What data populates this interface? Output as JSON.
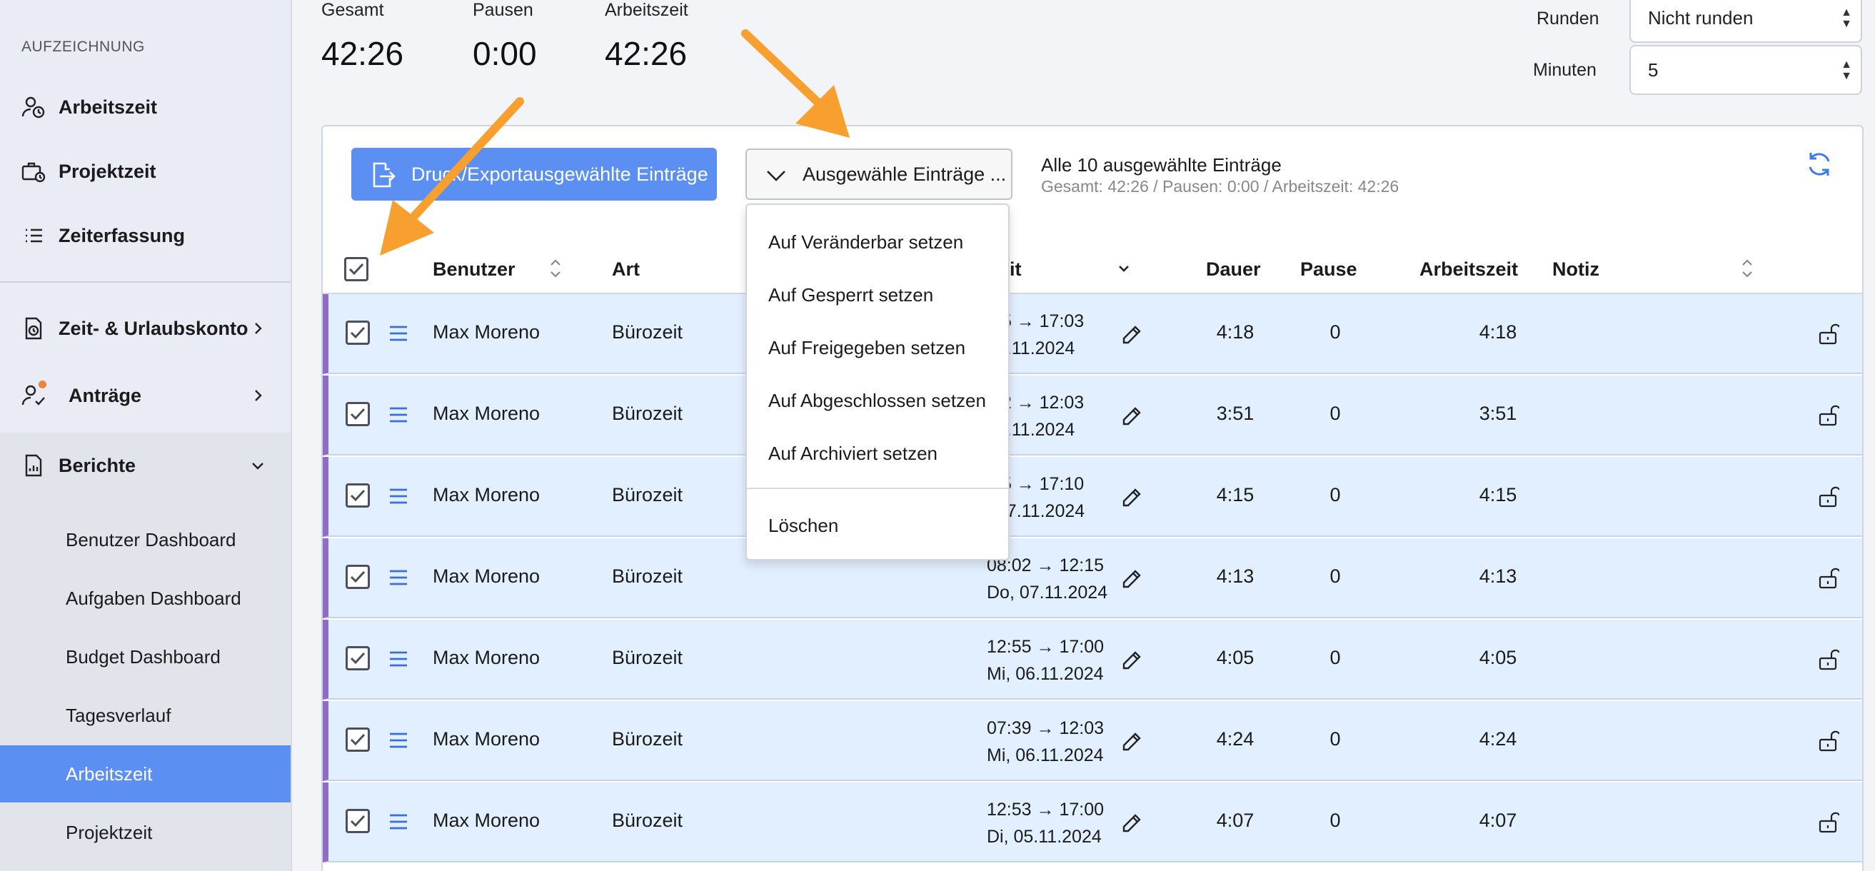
{
  "sidebar": {
    "section_label": "AUFZEICHNUNG",
    "items": [
      {
        "label": "Arbeitszeit"
      },
      {
        "label": "Projektzeit"
      },
      {
        "label": "Zeiterfassung"
      },
      {
        "label": "Zeit- & Urlaubskonto"
      },
      {
        "label": "Anträge"
      },
      {
        "label": "Berichte"
      }
    ],
    "sub_items": [
      {
        "label": "Benutzer Dashboard"
      },
      {
        "label": "Aufgaben Dashboard"
      },
      {
        "label": "Budget Dashboard"
      },
      {
        "label": "Tagesverlauf"
      },
      {
        "label": "Arbeitszeit"
      },
      {
        "label": "Projektzeit"
      }
    ],
    "active_sub_item": "Arbeitszeit",
    "notification_color": "#f0833a"
  },
  "stats": {
    "gesamt_label": "Gesamt",
    "gesamt_value": "42:26",
    "pausen_label": "Pausen",
    "pausen_value": "0:00",
    "arbeitszeit_label": "Arbeitszeit",
    "arbeitszeit_value": "42:26"
  },
  "controls": {
    "runden_label": "Runden",
    "runden_value": "Nicht runden",
    "minuten_label": "Minuten",
    "minuten_value": "5"
  },
  "toolbar": {
    "export_label": "Druck/Exportausgewählte Einträge",
    "selected_actions_label": "Ausgewähle Einträge ...",
    "selection_info": "Alle 10 ausgewählte Einträge",
    "selection_summary": "Gesamt: 42:26 / Pausen: 0:00 / Arbeitszeit: 42:26"
  },
  "dropdown": {
    "items": [
      "Auf Veränderbar setzen",
      "Auf Gesperrt setzen",
      "Auf Freigegeben setzen",
      "Auf Abgeschlossen setzen",
      "Auf Archiviert setzen",
      "Löschen"
    ]
  },
  "table": {
    "headers": {
      "benutzer": "Benutzer",
      "art": "Art",
      "zeit": "it",
      "dauer": "Dauer",
      "pause": "Pause",
      "arbeitszeit": "Arbeitszeit",
      "notiz": "Notiz"
    },
    "rows": [
      {
        "user": "Max Moreno",
        "type": "Bürozeit",
        "time": ":45 → 17:03",
        "date": "08.11.2024",
        "duration": "4:18",
        "pause": "0",
        "work": "4:18"
      },
      {
        "user": "Max Moreno",
        "type": "Bürozeit",
        "time": ":12 → 12:03",
        "date": "08.11.2024",
        "duration": "3:51",
        "pause": "0",
        "work": "3:51"
      },
      {
        "user": "Max Moreno",
        "type": "Bürozeit",
        "time": ":55 → 17:10",
        "date": ", 07.11.2024",
        "duration": "4:15",
        "pause": "0",
        "work": "4:15"
      },
      {
        "user": "Max Moreno",
        "type": "Bürozeit",
        "time": "08:02 → 12:15",
        "date": "Do, 07.11.2024",
        "duration": "4:13",
        "pause": "0",
        "work": "4:13"
      },
      {
        "user": "Max Moreno",
        "type": "Bürozeit",
        "time": "12:55 → 17:00",
        "date": "Mi, 06.11.2024",
        "duration": "4:05",
        "pause": "0",
        "work": "4:05"
      },
      {
        "user": "Max Moreno",
        "type": "Bürozeit",
        "time": "07:39 → 12:03",
        "date": "Mi, 06.11.2024",
        "duration": "4:24",
        "pause": "0",
        "work": "4:24"
      },
      {
        "user": "Max Moreno",
        "type": "Bürozeit",
        "time": "12:53 → 17:00",
        "date": "Di, 05.11.2024",
        "duration": "4:07",
        "pause": "0",
        "work": "4:07"
      }
    ]
  },
  "colors": {
    "accent": "#5b8ff2",
    "row_bg": "#e2efff",
    "row_marker": "#8f6cc9",
    "annotation_arrow": "#f7a030"
  }
}
